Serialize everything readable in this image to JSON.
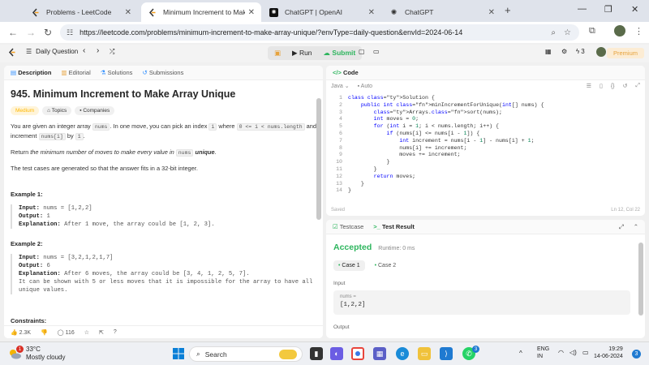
{
  "browser": {
    "tabs": [
      {
        "title": "Problems - LeetCode"
      },
      {
        "title": "Minimum Increment to Make A"
      },
      {
        "title": "ChatGPT | OpenAI"
      },
      {
        "title": "ChatGPT"
      }
    ],
    "url": "https://leetcode.com/problems/minimum-increment-to-make-array-unique/?envType=daily-question&envId=2024-06-14"
  },
  "toolbar": {
    "daily_label": "Daily Question",
    "run_label": "Run",
    "submit_label": "Submit",
    "streak": "3",
    "premium_label": "Premium"
  },
  "description_panel": {
    "tabs": [
      "Description",
      "Editorial",
      "Solutions",
      "Submissions"
    ],
    "title": "945. Minimum Increment to Make Array Unique",
    "difficulty": "Medium",
    "tag_topics": "Topics",
    "tag_companies": "Companies",
    "p1_a": "You are given an integer array ",
    "p1_code1": "nums",
    "p1_b": ". In one move, you can pick an index ",
    "p1_code2": "i",
    "p1_c": " where ",
    "p1_code3": "0 <= i < nums.length",
    "p1_d": " and increment ",
    "p1_code4": "nums[i]",
    "p1_e": " by ",
    "p1_code5": "1",
    "p1_f": ".",
    "p2_a": "Return ",
    "p2_em": "the minimum number of moves to make every value in",
    "p2_code": "nums",
    "p2_strong": "unique",
    "p2_end": ".",
    "p3": "The test cases are generated so that the answer fits in a 32-bit integer.",
    "example1_title": "Example 1:",
    "example1_input_label": "Input:",
    "example1_input": "nums = [1,2,2]",
    "example1_output_label": "Output:",
    "example1_output": "1",
    "example1_expl_label": "Explanation:",
    "example1_expl": "After 1 move, the array could be [1, 2, 3].",
    "example2_title": "Example 2:",
    "example2_input_label": "Input:",
    "example2_input": "nums = [3,2,1,2,1,7]",
    "example2_output_label": "Output:",
    "example2_output": "6",
    "example2_expl_label": "Explanation:",
    "example2_expl": "After 6 moves, the array could be [3, 4, 1, 2, 5, 7].",
    "example2_expl2": "It can be shown with 5 or less moves that it is impossible for the array to have all",
    "example2_expl3": "unique values.",
    "constraints_title": "Constraints:",
    "likes": "2.3K",
    "comments": "116"
  },
  "code_panel": {
    "title": "Code",
    "language": "Java",
    "mode": "Auto",
    "lines": [
      "class Solution {",
      "    public int minIncrementForUnique(int[] nums) {",
      "        Arrays.sort(nums);",
      "        int moves = 0;",
      "        for (int i = 1; i < nums.length; i++) {",
      "            if (nums[i] <= nums[i - 1]) {",
      "                int increment = nums[i - 1] - nums[i] + 1;",
      "                nums[i] += increment;",
      "                moves += increment;",
      "            }",
      "        }",
      "        return moves;",
      "    }",
      "}"
    ],
    "saved_label": "Saved",
    "cursor_pos": "Ln 12, Col 22"
  },
  "test_panel": {
    "tab_testcase": "Testcase",
    "tab_result": "Test Result",
    "status": "Accepted",
    "runtime": "Runtime: 0 ms",
    "case1": "Case 1",
    "case2": "Case 2",
    "input_label": "Input",
    "var_label": "nums =",
    "input_value": "[1,2,2]",
    "output_label": "Output"
  },
  "taskbar": {
    "temp": "33°C",
    "weather": "Mostly cloudy",
    "weather_badge": "1",
    "search_label": "Search",
    "whatsapp_badge": "3",
    "lang1": "ENG",
    "lang2": "IN",
    "time": "19:29",
    "date": "14-06-2024",
    "notif_badge": "3"
  }
}
